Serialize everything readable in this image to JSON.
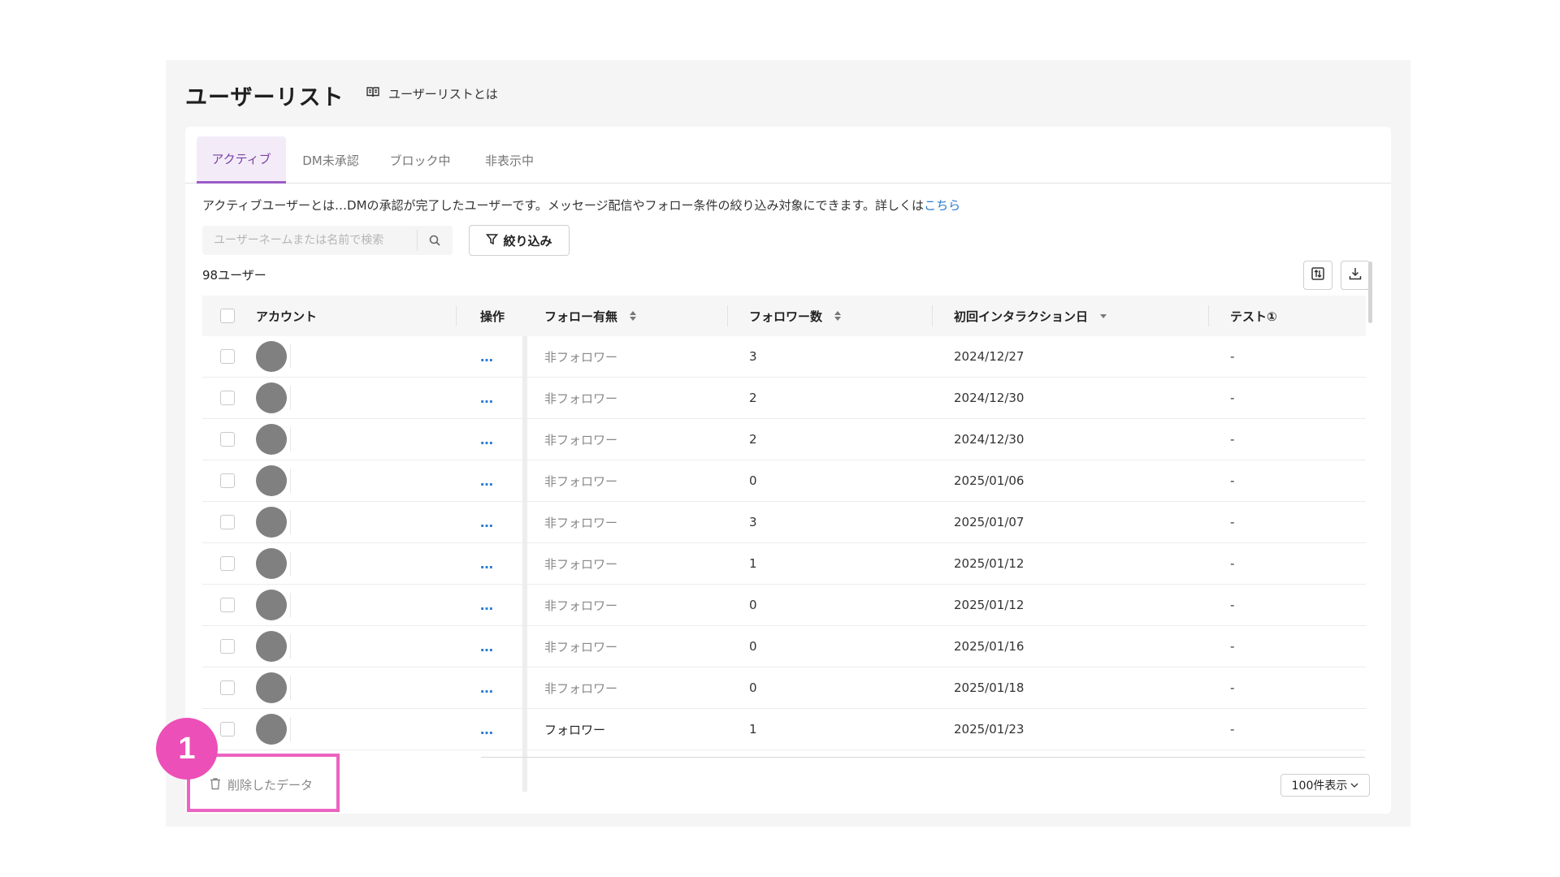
{
  "page": {
    "title": "ユーザーリスト",
    "help_link": "ユーザーリストとは"
  },
  "tabs": [
    {
      "label": "アクティブ",
      "active": true
    },
    {
      "label": "DM未承認",
      "active": false
    },
    {
      "label": "ブロック中",
      "active": false
    },
    {
      "label": "非表示中",
      "active": false
    }
  ],
  "notice": {
    "text": "アクティブユーザーとは…DMの承認が完了したユーザーです。メッセージ配信やフォロー条件の絞り込み対象にできます。詳しくは",
    "link": "こちら"
  },
  "search": {
    "placeholder": "ユーザーネームまたは名前で検索",
    "value": ""
  },
  "filter_label": "絞り込み",
  "user_count": "98ユーザー",
  "columns": {
    "account": "アカウント",
    "action": "操作",
    "follow_status": "フォロー有無",
    "follower_count": "フォロワー数",
    "first_interaction": "初回インタラクション日",
    "test": "テスト①"
  },
  "rows": [
    {
      "action": "…",
      "follow": "非フォロワー",
      "followers": "3",
      "date": "2024/12/27",
      "test": "-"
    },
    {
      "action": "…",
      "follow": "非フォロワー",
      "followers": "2",
      "date": "2024/12/30",
      "test": "-"
    },
    {
      "action": "…",
      "follow": "非フォロワー",
      "followers": "2",
      "date": "2024/12/30",
      "test": "-"
    },
    {
      "action": "…",
      "follow": "非フォロワー",
      "followers": "0",
      "date": "2025/01/06",
      "test": "-"
    },
    {
      "action": "…",
      "follow": "非フォロワー",
      "followers": "3",
      "date": "2025/01/07",
      "test": "-"
    },
    {
      "action": "…",
      "follow": "非フォロワー",
      "followers": "1",
      "date": "2025/01/12",
      "test": "-"
    },
    {
      "action": "…",
      "follow": "非フォロワー",
      "followers": "0",
      "date": "2025/01/12",
      "test": "-"
    },
    {
      "action": "…",
      "follow": "非フォロワー",
      "followers": "0",
      "date": "2025/01/16",
      "test": "-"
    },
    {
      "action": "…",
      "follow": "非フォロワー",
      "followers": "0",
      "date": "2025/01/18",
      "test": "-"
    },
    {
      "action": "…",
      "follow": "フォロワー",
      "followers": "1",
      "date": "2025/01/23",
      "test": "-"
    }
  ],
  "deleted_data_label": "削除したデータ",
  "annotation_badge": "1",
  "page_size": {
    "selected": "100件表示"
  },
  "colors": {
    "accent": "#9b5cc7",
    "tab_active_bg": "#f3ecf8",
    "link": "#2a7bd0",
    "highlight": "#ec63c0",
    "badge": "#ec4fb7",
    "avatar": "#808080"
  },
  "icons": {
    "help": "book-icon",
    "search": "search-icon",
    "filter": "filter-icon",
    "columns": "column-settings-icon",
    "download": "download-icon",
    "delete": "trash-icon",
    "dropdown": "chevron-down-icon"
  }
}
